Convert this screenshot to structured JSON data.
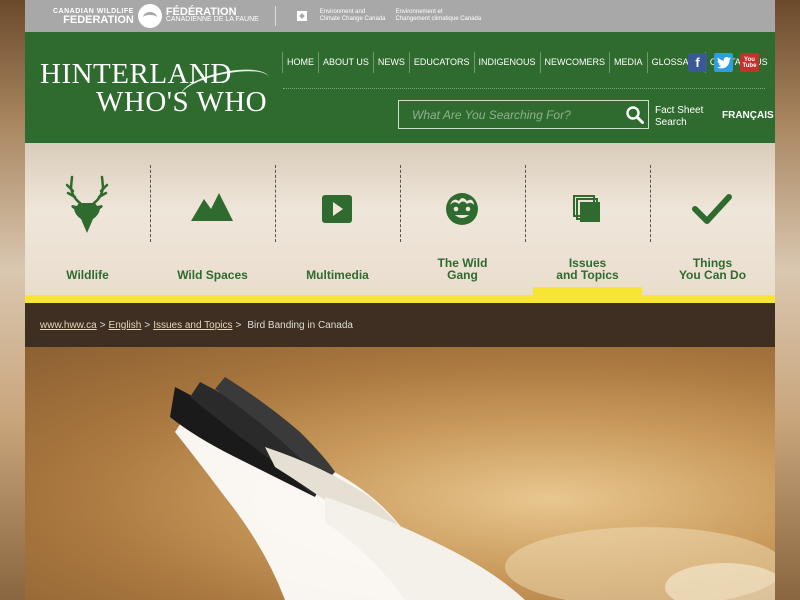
{
  "partners": {
    "cwf_en_small": "CANADIAN WILDLIFE",
    "cwf_en_big": "FEDERATION",
    "cwf_fr_big": "FÉDÉRATION",
    "cwf_fr_small": "CANADIENNE DE LA FAUNE",
    "eccc_en_1": "Environment and",
    "eccc_en_2": "Climate Change Canada",
    "eccc_fr_1": "Environnement et",
    "eccc_fr_2": "Changement climatique Canada"
  },
  "logo": {
    "line1": "HINTERLAND",
    "line2": "WHO'S WHO"
  },
  "nav": [
    "HOME",
    "ABOUT US",
    "NEWS",
    "EDUCATORS",
    "INDIGENOUS",
    "NEWCOMERS",
    "MEDIA",
    "GLOSSARY",
    "CONTACT US"
  ],
  "social": {
    "facebook": "f",
    "twitter": "t",
    "youtube_1": "You",
    "youtube_2": "Tube"
  },
  "search": {
    "placeholder": "What Are You Searching For?",
    "value": ""
  },
  "fact_sheet": {
    "line1": "Fact Sheet",
    "line2": "Search"
  },
  "language_link": "FRANÇAIS",
  "categories": [
    {
      "line1": "Wildlife",
      "line2": "",
      "icon": "deer-icon"
    },
    {
      "line1": "Wild Spaces",
      "line2": "",
      "icon": "mountain-icon"
    },
    {
      "line1": "Multimedia",
      "line2": "",
      "icon": "play-icon"
    },
    {
      "line1": "The Wild",
      "line2": "Gang",
      "icon": "kid-face-icon"
    },
    {
      "line1": "Issues",
      "line2": "and Topics",
      "icon": "stacked-pages-icon",
      "active": true
    },
    {
      "line1": "Things",
      "line2": "You Can Do",
      "icon": "checkmark-icon"
    }
  ],
  "breadcrumb": {
    "home": "www.hww.ca",
    "lang": "English",
    "section": "Issues and Topics",
    "current": "Bird Banding in Canada",
    "separator": ">"
  },
  "colors": {
    "brand_green": "#2f6b2f",
    "accent_yellow": "#f6e533",
    "crumb_bg": "#3e2f22"
  }
}
